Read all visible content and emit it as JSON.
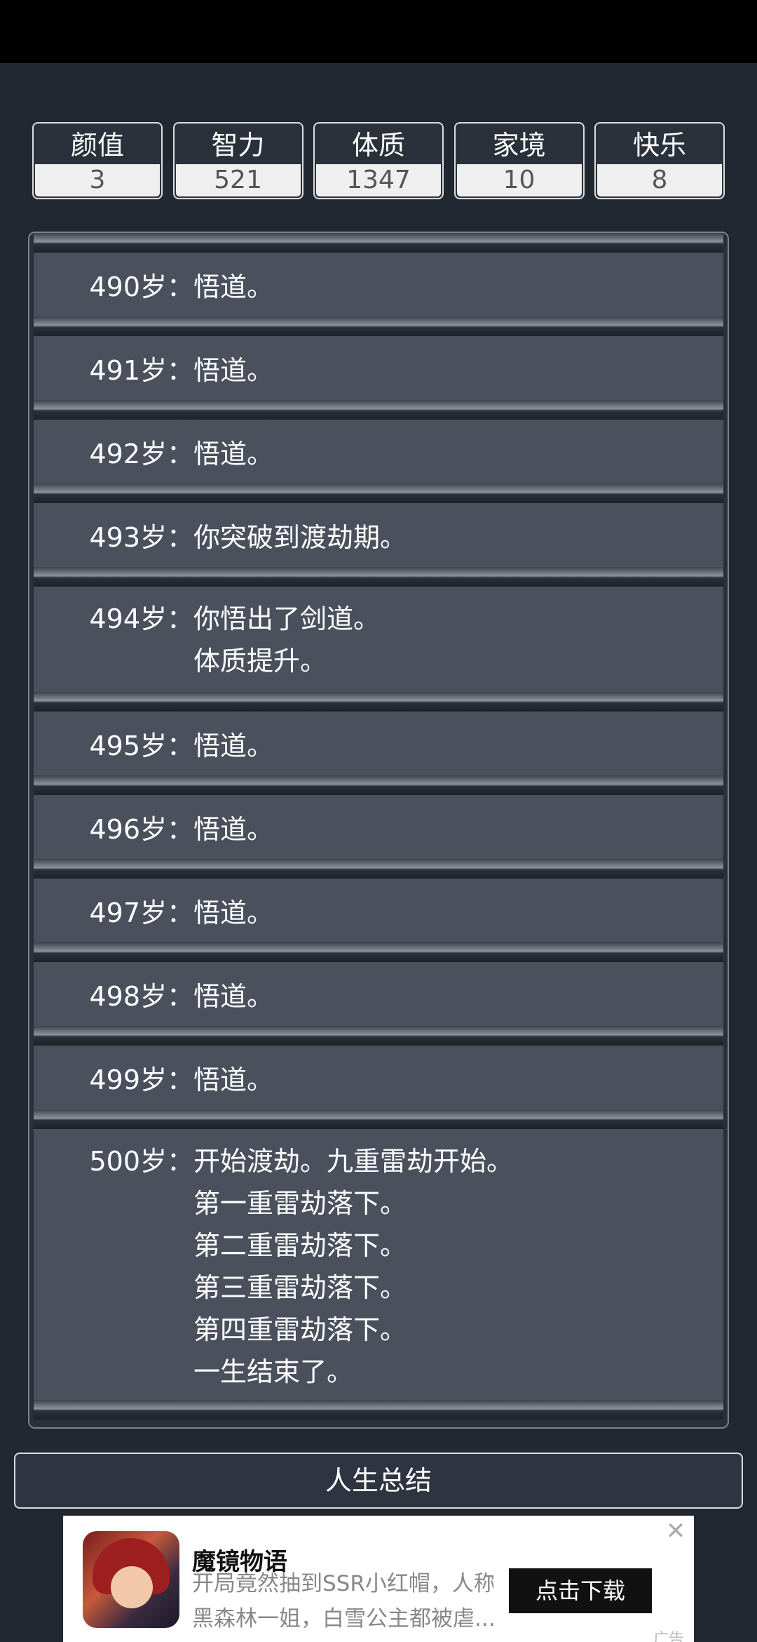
{
  "stats": [
    {
      "label": "颜值",
      "value": "3"
    },
    {
      "label": "智力",
      "value": "521"
    },
    {
      "label": "体质",
      "value": "1347"
    },
    {
      "label": "家境",
      "value": "10"
    },
    {
      "label": "快乐",
      "value": "8"
    }
  ],
  "log": [
    {
      "age": "490岁：",
      "lines": [
        "悟道。"
      ]
    },
    {
      "age": "491岁：",
      "lines": [
        "悟道。"
      ]
    },
    {
      "age": "492岁：",
      "lines": [
        "悟道。"
      ]
    },
    {
      "age": "493岁：",
      "lines": [
        "你突破到渡劫期。"
      ]
    },
    {
      "age": "494岁：",
      "lines": [
        "你悟出了剑道。",
        "体质提升。"
      ]
    },
    {
      "age": "495岁：",
      "lines": [
        "悟道。"
      ]
    },
    {
      "age": "496岁：",
      "lines": [
        "悟道。"
      ]
    },
    {
      "age": "497岁：",
      "lines": [
        "悟道。"
      ]
    },
    {
      "age": "498岁：",
      "lines": [
        "悟道。"
      ]
    },
    {
      "age": "499岁：",
      "lines": [
        "悟道。"
      ]
    },
    {
      "age": "500岁：",
      "lines": [
        "开始渡劫。九重雷劫开始。",
        "第一重雷劫落下。",
        "第二重雷劫落下。",
        "第三重雷劫落下。",
        "第四重雷劫落下。",
        "一生结束了。"
      ]
    }
  ],
  "summary_button": "人生总结",
  "ad": {
    "title": "魔镜物语",
    "desc_line1": "开局竟然抽到SSR小红帽，人称",
    "desc_line2": "黑森林一姐，白雪公主都被虐...",
    "cta": "点击下载",
    "close_icon": "close-icon",
    "tag": "广告"
  }
}
